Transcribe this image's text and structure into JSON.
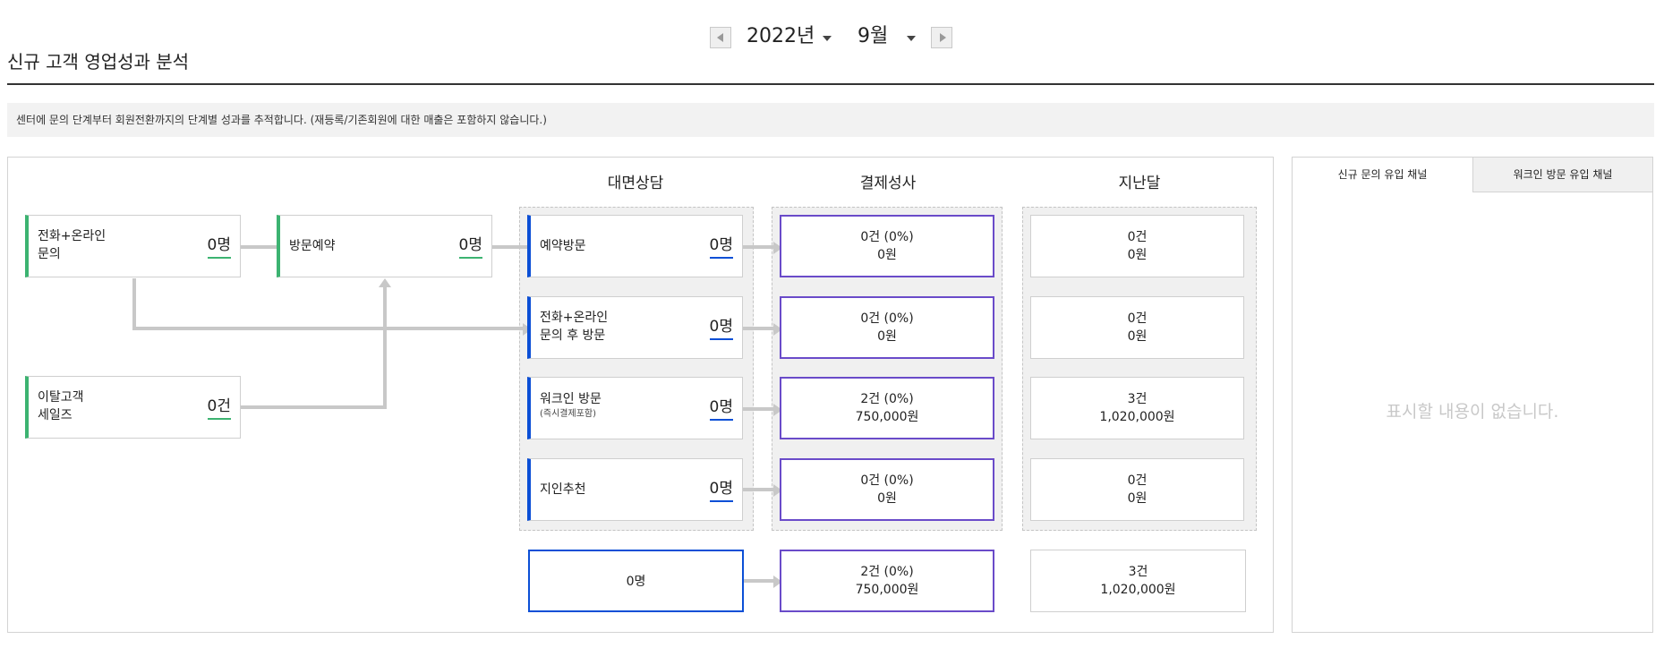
{
  "selector": {
    "year": "2022년",
    "month": "9월"
  },
  "page": {
    "title": "신규 고객 영업성과 분석",
    "info": "센터에 문의 단계부터 회원전환까지의 단계별 성과를 추적합니다. (재등록/기존회원에 대한 매출은 포함하지 않습니다.)"
  },
  "columns": {
    "consult": "대면상담",
    "payment": "결제성사",
    "last_month": "지난달"
  },
  "inflow": [
    {
      "label": "전화+온라인\n문의",
      "count": "0명"
    },
    {
      "label": "방문예약",
      "count": "0명"
    },
    {
      "label": "이탈고객\n세일즈",
      "count": "0건"
    }
  ],
  "rows": [
    {
      "label": "예약방문",
      "sub": "",
      "count": "0명",
      "payment": {
        "cases": "0건 (0%)",
        "amount": "0원"
      },
      "last_month": {
        "cases": "0건",
        "amount": "0원"
      }
    },
    {
      "label": "전화+온라인\n문의 후 방문",
      "sub": "",
      "count": "0명",
      "payment": {
        "cases": "0건 (0%)",
        "amount": "0원"
      },
      "last_month": {
        "cases": "0건",
        "amount": "0원"
      }
    },
    {
      "label": "워크인 방문",
      "sub": "(즉시결제포함)",
      "count": "0명",
      "payment": {
        "cases": "2건 (0%)",
        "amount": "750,000원"
      },
      "last_month": {
        "cases": "3건",
        "amount": "1,020,000원"
      }
    },
    {
      "label": "지인추천",
      "sub": "",
      "count": "0명",
      "payment": {
        "cases": "0건 (0%)",
        "amount": "0원"
      },
      "last_month": {
        "cases": "0건",
        "amount": "0원"
      }
    }
  ],
  "totals": {
    "consult": "0명",
    "payment": {
      "cases": "2건 (0%)",
      "amount": "750,000원"
    },
    "last_month": {
      "cases": "3건",
      "amount": "1,020,000원"
    }
  },
  "side_panel": {
    "tabs": [
      "신규 문의 유입 채널",
      "워크인 방문 유입 채널"
    ],
    "empty": "표시할 내용이 없습니다."
  },
  "colors": {
    "inflow_accent": "#3cb371",
    "consult_accent": "#0b4fd6",
    "payment_border": "#6a4bc9",
    "connector": "#c8c8c8"
  }
}
